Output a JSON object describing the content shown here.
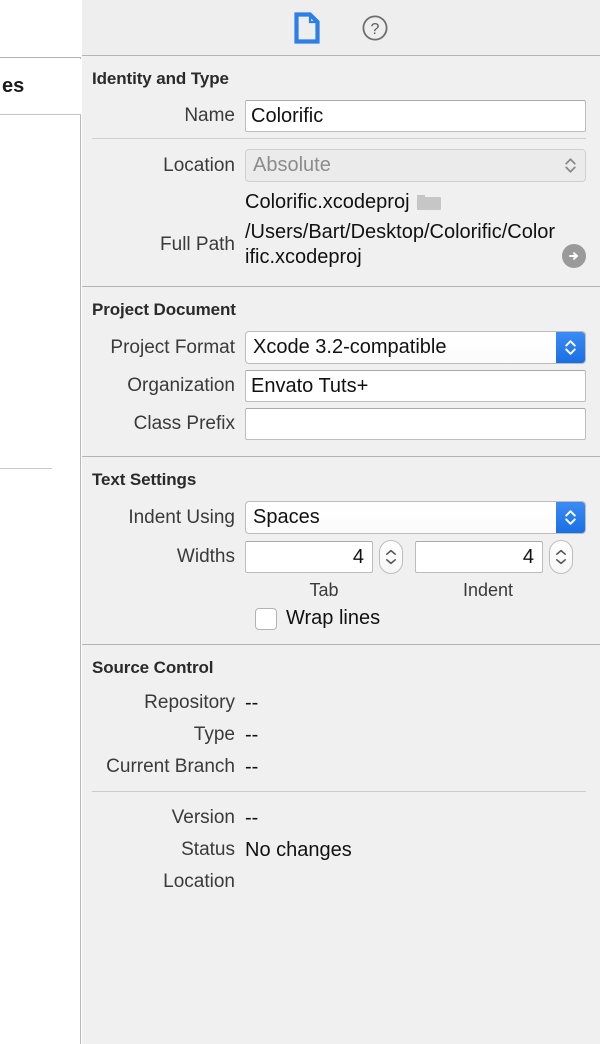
{
  "left_panel": {
    "visible_row_label": "es"
  },
  "toolbar": {
    "file_inspector_icon": "document-icon",
    "help_icon": "help-icon",
    "accent_blue": "#2a7fe8",
    "help_gray": "#6e6e6e"
  },
  "sections": {
    "identity": {
      "title": "Identity and Type",
      "name_label": "Name",
      "name_value": "Colorific",
      "location_label": "Location",
      "location_value": "Absolute",
      "file_name": "Colorific.xcodeproj",
      "full_path_label": "Full Path",
      "full_path_value": "/Users/Bart/Desktop/Colorific/Colorific.xcodeproj"
    },
    "project_document": {
      "title": "Project Document",
      "project_format_label": "Project Format",
      "project_format_value": "Xcode 3.2-compatible",
      "organization_label": "Organization",
      "organization_value": "Envato Tuts+",
      "class_prefix_label": "Class Prefix",
      "class_prefix_value": ""
    },
    "text_settings": {
      "title": "Text Settings",
      "indent_using_label": "Indent Using",
      "indent_using_value": "Spaces",
      "widths_label": "Widths",
      "tab_width_value": "4",
      "indent_width_value": "4",
      "tab_caption": "Tab",
      "indent_caption": "Indent",
      "wrap_lines_label": "Wrap lines",
      "wrap_lines_checked": false
    },
    "source_control": {
      "title": "Source Control",
      "repository_label": "Repository",
      "repository_value": "--",
      "type_label": "Type",
      "type_value": "--",
      "current_branch_label": "Current Branch",
      "current_branch_value": "--",
      "version_label": "Version",
      "version_value": "--",
      "status_label": "Status",
      "status_value": "No changes",
      "location_label": "Location",
      "location_value": ""
    }
  }
}
